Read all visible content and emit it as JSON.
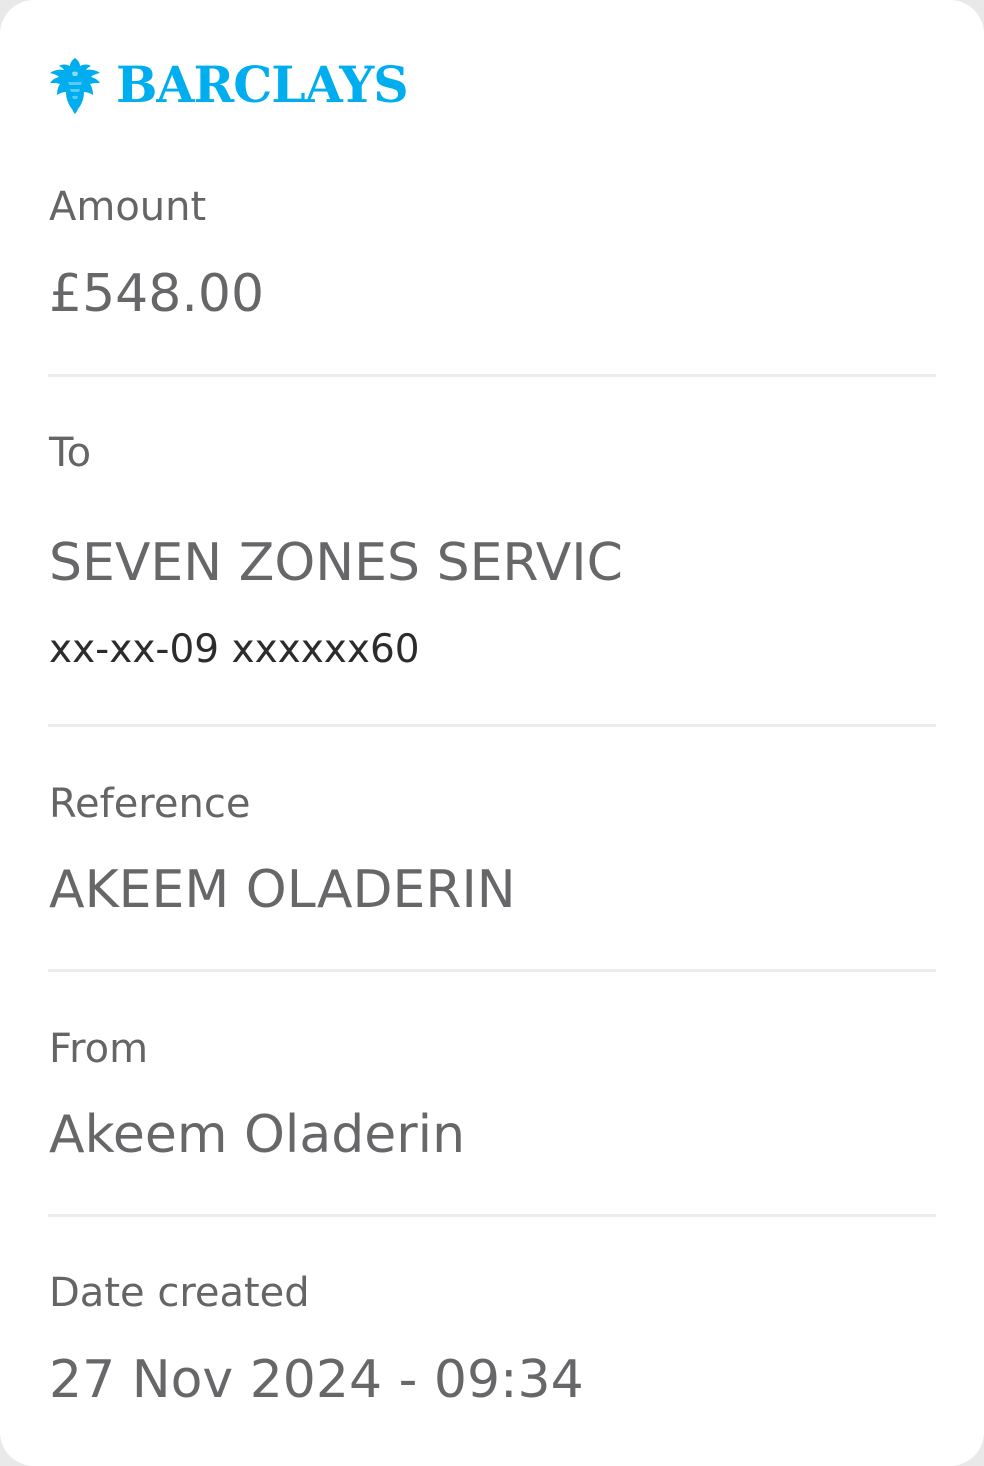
{
  "brand": {
    "name": "BARCLAYS",
    "logo_icon": "eagle-icon",
    "color": "#00aeef"
  },
  "amount": {
    "label": "Amount",
    "value": "£548.00"
  },
  "to": {
    "label": "To",
    "name": "SEVEN ZONES SERVIC",
    "account": "xx-xx-09 xxxxxx60"
  },
  "reference": {
    "label": "Reference",
    "value": "AKEEM OLADERIN"
  },
  "from": {
    "label": "From",
    "value": "Akeem Oladerin"
  },
  "date_created": {
    "label": "Date created",
    "value": "27 Nov 2024 - 09:34"
  }
}
